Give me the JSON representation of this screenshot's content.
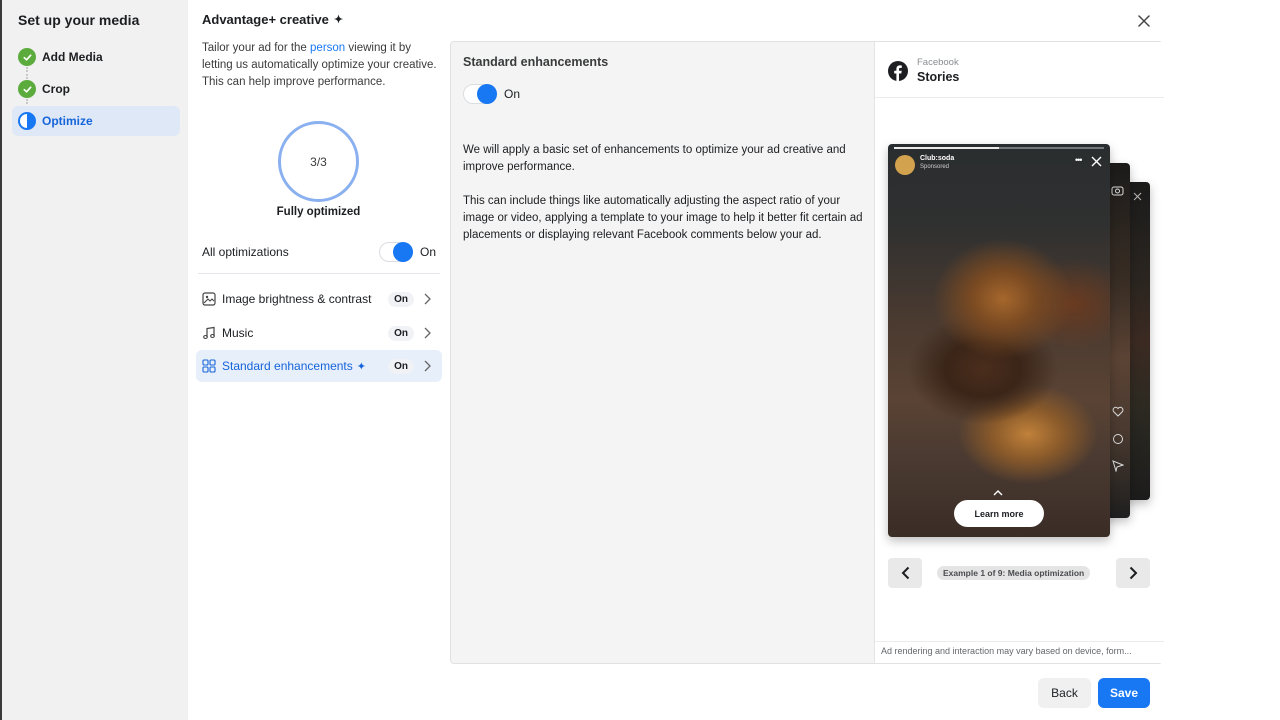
{
  "sidebar": {
    "title": "Set up your media",
    "steps": [
      {
        "label": "Add Media",
        "status": "complete",
        "icon": "check-circle-icon"
      },
      {
        "label": "Crop",
        "status": "complete",
        "icon": "check-circle-icon"
      },
      {
        "label": "Optimize",
        "status": "in-progress",
        "icon": "half-circle-icon"
      }
    ]
  },
  "dialog": {
    "title": "Advantage+ creative",
    "title_icon": "sparkle-icon",
    "close_icon": "close-icon",
    "intro_before": "Tailor your ad for the ",
    "intro_link": "person",
    "intro_after": " viewing it by letting us automatically optimize your creative. This can help improve performance.",
    "progress": {
      "text": "3/3",
      "completed": 3,
      "total": 3,
      "caption": "Fully optimized"
    },
    "all_optimizations": {
      "label": "All optimizations",
      "state": "On",
      "enabled": true
    },
    "options": [
      {
        "label": "Image brightness & contrast",
        "badge": "On",
        "icon": "image-icon",
        "active": false
      },
      {
        "label": "Music",
        "badge": "On",
        "icon": "music-note-icon",
        "active": false
      },
      {
        "label": "Standard enhancements",
        "badge": "On",
        "icon": "grid-icon",
        "active": true,
        "sparkle": true
      }
    ]
  },
  "detail": {
    "title": "Standard enhancements",
    "toggle_state": "On",
    "toggle_enabled": true,
    "paragraph1": "We will apply a basic set of enhancements to optimize your ad creative and improve performance.",
    "paragraph2": "This can include things like automatically adjusting the aspect ratio of your image or video, applying a template to your image to help it better fit certain ad placements or displaying relevant Facebook comments below your ad."
  },
  "preview": {
    "platform": "Facebook",
    "placement": "Stories",
    "story": {
      "account_name": "Club:soda",
      "sponsored": "Sponsored",
      "cta": "Learn more"
    },
    "example_label": "Example 1 of 9: Media optimization",
    "disclaimer": "Ad rendering and interaction may vary based on device, form..."
  },
  "footer": {
    "back_label": "Back",
    "save_label": "Save"
  },
  "colors": {
    "accent": "#1877f2",
    "step_complete": "#5bac3d",
    "active_row_bg": "#e7effb"
  }
}
